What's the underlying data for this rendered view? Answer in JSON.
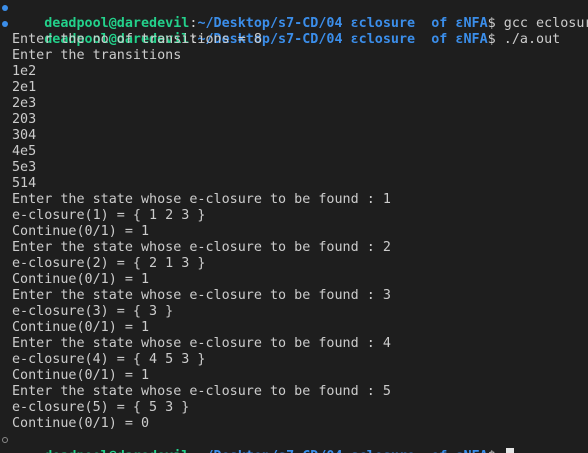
{
  "terminal": {
    "prompt": {
      "user_host": "deadpool@daredevil",
      "colon": ":",
      "path": "~/Desktop/s7-CD/04 εclosure  of εNFA",
      "symbol": "$"
    },
    "first_command": " gcc eclosure.c",
    "second_command": " ./a.out",
    "output_lines": [
      "Enter the no of transitions = 8",
      "Enter the transitions",
      "1e2",
      "2e1",
      "2e3",
      "203",
      "304",
      "4e5",
      "5e3",
      "514",
      "Enter the state whose e-closure to be found : 1",
      "e-closure(1) = { 1 2 3 }",
      "Continue(0/1) = 1",
      "Enter the state whose e-closure to be found : 2",
      "e-closure(2) = { 2 1 3 }",
      "Continue(0/1) = 1",
      "Enter the state whose e-closure to be found : 3",
      "e-closure(3) = { 3 }",
      "Continue(0/1) = 1",
      "Enter the state whose e-closure to be found : 4",
      "e-closure(4) = { 4 5 3 }",
      "Continue(0/1) = 1",
      "Enter the state whose e-closure to be found : 5",
      "e-closure(5) = { 5 3 }",
      "Continue(0/1) = 0"
    ]
  },
  "colors": {
    "background": "#1e1e1e",
    "text": "#cccccc",
    "user_host": "#23d18b",
    "path": "#3b8eea",
    "dot_success": "#3b8eea"
  }
}
